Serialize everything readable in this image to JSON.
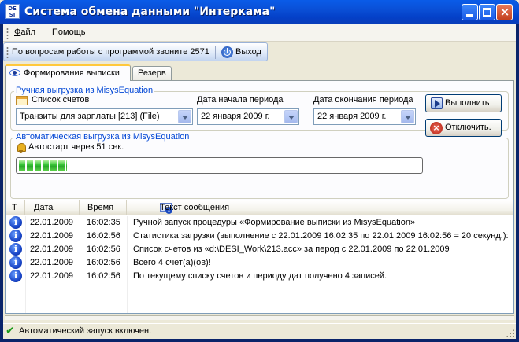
{
  "window": {
    "title": "Система обмена данными \"Интеркама\"",
    "icon_text": "DE SI"
  },
  "menu": {
    "file": "Файл",
    "help": "Помощь"
  },
  "toolbar": {
    "support_text": "По вопросам работы с программой звоните 2571",
    "exit_label": "Выход"
  },
  "tabs": [
    {
      "label": "Формирования выписки",
      "active": true
    },
    {
      "label": "Резерв",
      "active": false
    }
  ],
  "manual_group": {
    "title": "Ручная выгрузка из MisysEquation",
    "accounts_label": "Список счетов",
    "accounts_value": "Транзиты для зарплаты [213] (File)",
    "start_label": "Дата начала периода",
    "start_value": "22  января   2009 г.",
    "end_label": "Дата окончания периода",
    "end_value": "22  января   2009 г.",
    "run_button": "Выполнить"
  },
  "auto_group": {
    "title": "Автоматическая выгрузка из MisysEquation",
    "autostart_text": "Автостарт через 51 сек.",
    "progress_fraction": 0.12,
    "disable_button": "Отключить."
  },
  "log": {
    "columns": {
      "type": "T",
      "date": "Дата",
      "time": "Время",
      "message": "Текст сообщения"
    },
    "rows": [
      {
        "icon": "info-icon",
        "date": "22.01.2009",
        "time": "16:02:35",
        "message": "Ручной запуск процедуры «Формирование выписки из MisysEquation»"
      },
      {
        "icon": "info-icon",
        "date": "22.01.2009",
        "time": "16:02:56",
        "message": "Статистика загрузки (выполнение с 22.01.2009 16:02:35 по 22.01.2009 16:02:56 = 20 секунд.):"
      },
      {
        "icon": "info-icon",
        "date": "22.01.2009",
        "time": "16:02:56",
        "message": "Список счетов из «d:\\DESI_Work\\213.acc» за перод с 22.01.2009 по 22.01.2009"
      },
      {
        "icon": "info-icon",
        "date": "22.01.2009",
        "time": "16:02:56",
        "message": "Всего 4 счет(а)(ов)!"
      },
      {
        "icon": "info-icon",
        "date": "22.01.2009",
        "time": "16:02:56",
        "message": "По текущему списку счетов и периоду дат получено 4 записей."
      }
    ]
  },
  "status": {
    "text": "Автоматический запуск включен."
  }
}
